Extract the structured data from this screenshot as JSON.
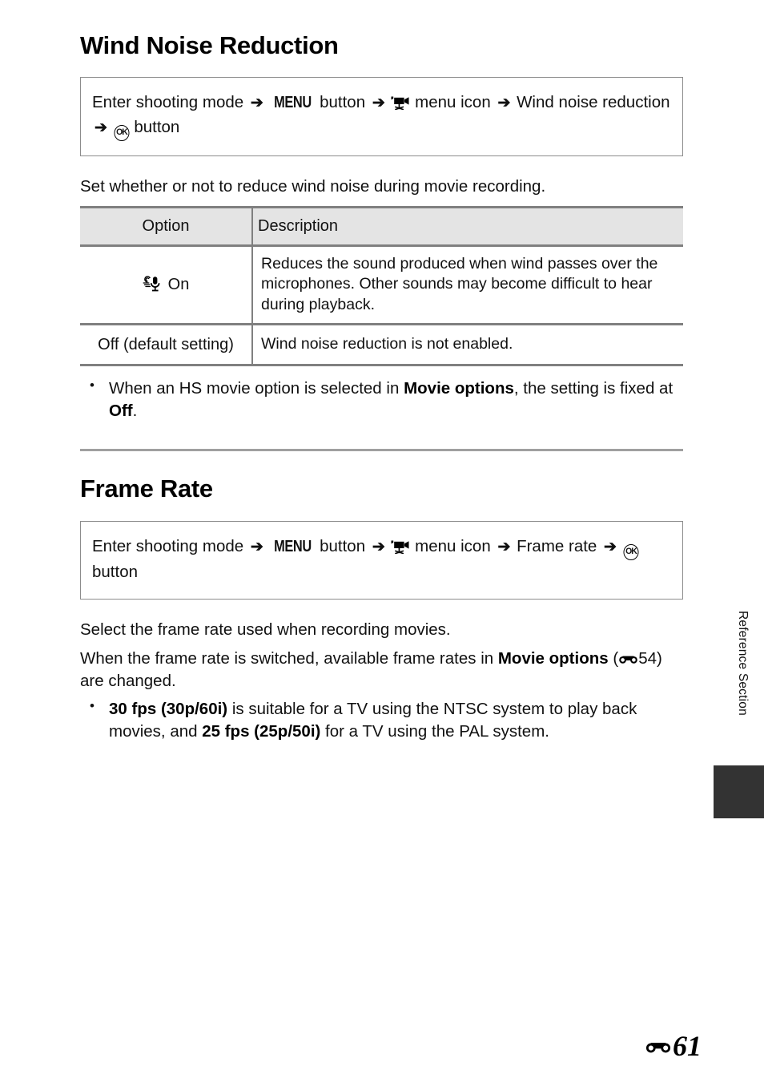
{
  "page": {
    "number": "61",
    "number_prefix_icon": "e-reference-icon",
    "side_label": "Reference Section"
  },
  "sections": [
    {
      "title": "Wind Noise Reduction",
      "nav_path": {
        "part1": "Enter shooting mode",
        "arrow": "➔",
        "menu_button_glyph": "MENU",
        "part2": "button",
        "menu_icon": "movie-menu-icon",
        "part3": "menu icon",
        "part4": "Wind noise reduction",
        "ok_button_glyph": "OK",
        "part5": "button"
      },
      "intro": "Set whether or not to reduce wind noise during movie recording.",
      "table": {
        "headers": [
          "Option",
          "Description"
        ],
        "rows": [
          {
            "icon": "wind-mic-icon",
            "option": "On",
            "description": "Reduces the sound produced when wind passes over the microphones. Other sounds may become difficult to hear during playback."
          },
          {
            "icon": "",
            "option": "Off (default setting)",
            "description": "Wind noise reduction is not enabled."
          }
        ]
      },
      "bullets": [
        {
          "pre": "When an HS movie option is selected in ",
          "bold1": "Movie options",
          "mid": ", the setting is fixed at ",
          "bold2": "Off",
          "post": "."
        }
      ]
    },
    {
      "title": "Frame Rate",
      "nav_path": {
        "part1": "Enter shooting mode",
        "arrow": "➔",
        "menu_button_glyph": "MENU",
        "part2": "button",
        "menu_icon": "movie-menu-icon",
        "part3": "menu icon",
        "part4": "Frame rate",
        "ok_button_glyph": "OK",
        "part5": "button"
      },
      "paragraphs": [
        "Select the frame rate used when recording movies.",
        {
          "pre": "When the frame rate is switched, available frame rates in ",
          "bold": "Movie options",
          "mid": " (",
          "ref_icon": "e-reference-icon",
          "ref_page": "54",
          "post": ") are changed."
        }
      ],
      "bullets": [
        {
          "bold1": "30 fps (30p/60i)",
          "mid1": " is suitable for a TV using the NTSC system to play back movies, and ",
          "bold2": "25 fps (25p/50i)",
          "post": " for a TV using the PAL system."
        }
      ]
    }
  ]
}
